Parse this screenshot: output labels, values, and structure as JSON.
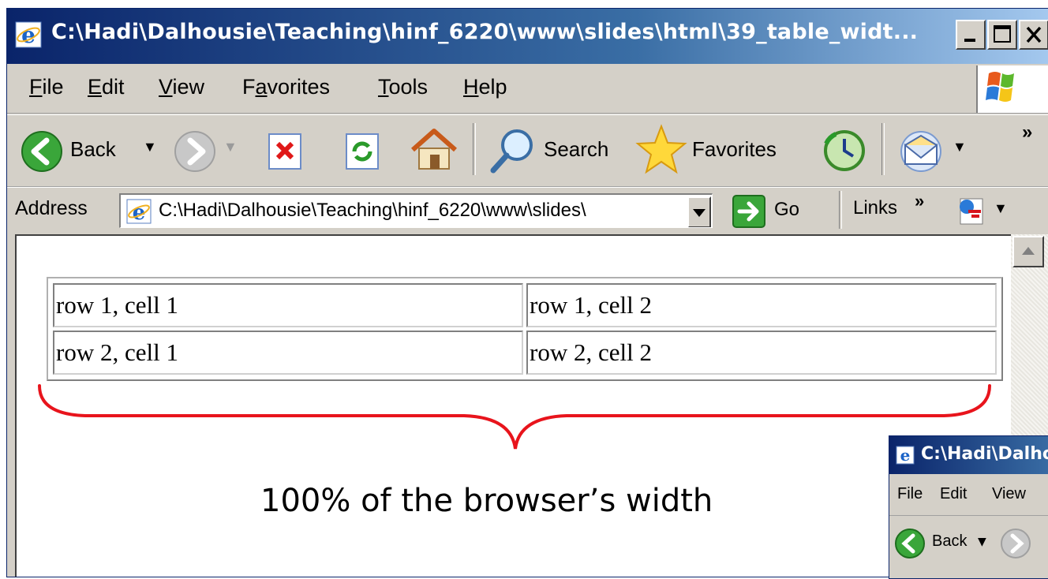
{
  "window": {
    "title": "C:\\Hadi\\Dalhousie\\Teaching\\hinf_6220\\www\\slides\\html\\39_table_widt..."
  },
  "menu": {
    "items": [
      "File",
      "Edit",
      "View",
      "Favorites",
      "Tools",
      "Help"
    ],
    "mnemonics": [
      "F",
      "E",
      "V",
      "a",
      "T",
      "H"
    ]
  },
  "toolbar": {
    "back_label": "Back",
    "search_label": "Search",
    "favorites_label": "Favorites",
    "overflow_label": "»"
  },
  "address": {
    "label": "Address",
    "value": "C:\\Hadi\\Dalhousie\\Teaching\\hinf_6220\\www\\slides\\",
    "go_label": "Go",
    "links_label": "Links",
    "links_overflow": "»"
  },
  "table": {
    "rows": [
      [
        "row 1, cell 1",
        "row 1, cell 2"
      ],
      [
        "row 2, cell 1",
        "row 2, cell 2"
      ]
    ]
  },
  "annotation": {
    "caption": "100% of the browser’s width",
    "brace_color": "#e8141c"
  },
  "secondary_window": {
    "title": "C:\\Hadi\\Dalhou",
    "menu": [
      "File",
      "Edit",
      "View"
    ],
    "back_label": "Back"
  },
  "colors": {
    "titlebar": "#0a246a",
    "chrome": "#d4d0c8"
  }
}
